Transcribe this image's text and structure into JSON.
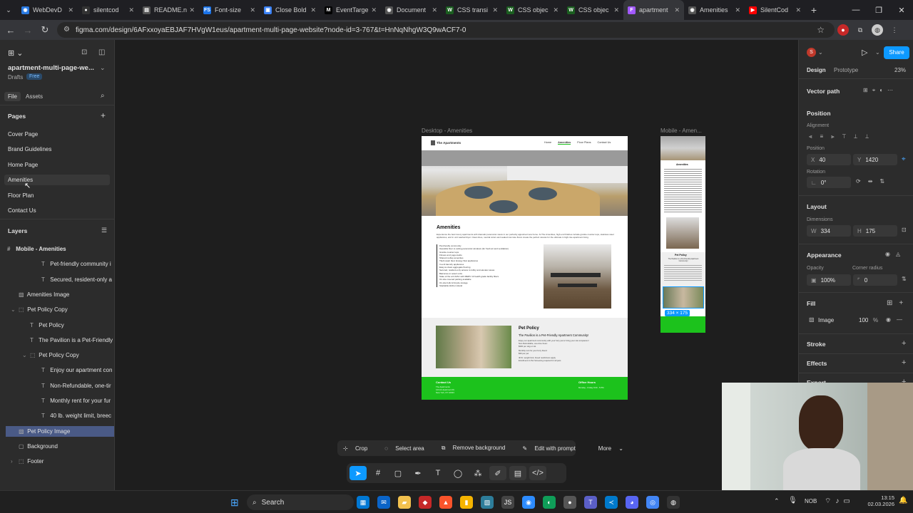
{
  "browser": {
    "tabs": [
      {
        "label": "WebDevD",
        "fav_color": "#2a7ae2",
        "fav_glyph": "◉"
      },
      {
        "label": "silentcod",
        "fav_color": "#333333",
        "fav_glyph": "●"
      },
      {
        "label": "README.n",
        "fav_color": "#555555",
        "fav_glyph": "▤"
      },
      {
        "label": "Font-size",
        "fav_color": "#1a73e8",
        "fav_glyph": "FS"
      },
      {
        "label": "Close Bold",
        "fav_color": "#3b82f6",
        "fav_glyph": "▣"
      },
      {
        "label": "EventTarge",
        "fav_color": "#000000",
        "fav_glyph": "M"
      },
      {
        "label": "Document",
        "fav_color": "#555555",
        "fav_glyph": "◉"
      },
      {
        "label": "CSS transi",
        "fav_color": "#1b5e20",
        "fav_glyph": "W"
      },
      {
        "label": "CSS objec",
        "fav_color": "#1b5e20",
        "fav_glyph": "W"
      },
      {
        "label": "CSS objec",
        "fav_color": "#1b5e20",
        "fav_glyph": "W"
      },
      {
        "label": "apartment",
        "fav_color": "#a259ff",
        "fav_glyph": "F",
        "active": true
      },
      {
        "label": "Amenities",
        "fav_color": "#555555",
        "fav_glyph": "◉"
      },
      {
        "label": "SilentCod",
        "fav_color": "#ff0000",
        "fav_glyph": "▶"
      }
    ],
    "url": "figma.com/design/6AFxxoyaEBJAF7HVgW1eus/apartment-multi-page-website?node-id=3-767&t=HnNqNhgW3Q9wACF7-0"
  },
  "left_panel": {
    "file_name": "apartment-multi-page-we...",
    "drafts": "Drafts",
    "plan_badge": "Free",
    "tab_file": "File",
    "tab_assets": "Assets",
    "pages_header": "Pages",
    "pages": [
      "Cover Page",
      "Brand Guidelines",
      "Home Page",
      "Amenities",
      "Floor Plan",
      "Contact Us"
    ],
    "layers_header": "Layers",
    "layers": [
      {
        "label": "Mobile - Amenities",
        "icon": "#",
        "indent": 0,
        "bold": true
      },
      {
        "label": "Pet-friendly community i",
        "icon": "T",
        "indent": 3
      },
      {
        "label": "Secured, resident-only a",
        "icon": "T",
        "indent": 3
      },
      {
        "label": "Amenities Image",
        "icon": "▧",
        "indent": 1
      },
      {
        "label": "Pet Policy Copy",
        "icon": "⬚",
        "indent": 1,
        "caret": "⌄"
      },
      {
        "label": "Pet Policy",
        "icon": "T",
        "indent": 2
      },
      {
        "label": "The Pavilion is a Pet-Friendly",
        "icon": "T",
        "indent": 2
      },
      {
        "label": "Pet Policy Copy",
        "icon": "⬚",
        "indent": 2,
        "caret": "⌄"
      },
      {
        "label": "Enjoy our apartment con",
        "icon": "T",
        "indent": 3
      },
      {
        "label": "Non-Refundable, one-tir",
        "icon": "T",
        "indent": 3
      },
      {
        "label": "Monthly rent for your fur",
        "icon": "T",
        "indent": 3
      },
      {
        "label": "40 lb. weight limit, breec",
        "icon": "T",
        "indent": 3
      },
      {
        "label": "Pet Policy Image",
        "icon": "▧",
        "indent": 1,
        "selected": true
      },
      {
        "label": "Background",
        "icon": "▢",
        "indent": 1
      },
      {
        "label": "Footer",
        "icon": "⬚",
        "indent": 1,
        "caret": "›"
      }
    ]
  },
  "canvas": {
    "desktop_frame_label": "Desktop - Amenities",
    "mobile_frame_label": "Mobile - Amen...",
    "selection_size": "334 × 175",
    "site": {
      "brand": "The Apartments",
      "nav": [
        "Home",
        "Amenities",
        "Floor Plans",
        "Contact Us"
      ],
      "amenities_title": "Amenities",
      "amenities_intro": "Experience the best luxury apartments with dramatic panoramic views in our perfectly appointed new home. At The Amenities, high end finishes include granite counter tops, stainless steel appliances, and in unit washer/dryer. Clean lines, neutral colors and sealed concrete floors create the perfect canvas for the ultimate in high-rise apartment living.",
      "amenities_list": [
        "Pet-friendly community",
        "Operable floor to ceiling panoramic windows (for fresh air and ventilation)",
        "Granite counter tops",
        "Fitness and yoga studio",
        "Shared rooftop amenities",
        "Tile/mosaic tiled, Energy Star appliances",
        "In-unit laundry appliances",
        "Easy-to-clean aggregate flooring",
        "Secured, resident-only access to lobby and elevator areas",
        "Balconies in select units",
        "State of the art HVAC with MERV 13 health grade facility filters",
        "On-site covered parking available",
        "On-site bulk & bicycle storage",
        "Stackable kitchen island"
      ],
      "pet_title": "Pet Policy",
      "pet_subtitle": "The Pavilion is a Pet-Friendly Apartment Community!",
      "pet_lines": [
        "Enjoy our apartment community with your furry pal or bring your cat companion!",
        "Non-Refundable, one-time Fees:",
        "$300 per dog or cat",
        "Monthly rent for your furry friend",
        "$30 per pet",
        "40 lb. weight limit, breed restrictions apply",
        "Enrollment in Pet Screening required for all pets"
      ],
      "footer_contact_title": "Contact Us",
      "footer_contact_lines": [
        "The Apartments",
        "123 Art Apartment Dr.",
        "New York, NY 10023"
      ],
      "footer_hours_title": "Office Hours",
      "footer_hours": "Monday - Friday 9:00 - 5 PM",
      "mobile_pet_title": "Pet Policy",
      "mobile_pet_sub": "The Pavilion is a Pet-Friendly Apartment Community!"
    },
    "context_toolbar": [
      "Crop",
      "Select area",
      "Remove background",
      "Edit with prompt",
      "More"
    ],
    "accent_green": "#1cc21c"
  },
  "right_panel": {
    "avatar": "S",
    "share": "Share",
    "tab_design": "Design",
    "tab_prototype": "Prototype",
    "zoom": "23%",
    "selection_type": "Vector path",
    "position_header": "Position",
    "alignment_label": "Alignment",
    "position_label": "Position",
    "x_key": "X",
    "x": "40",
    "y_key": "Y",
    "y": "1420",
    "rotation_label": "Rotation",
    "rotation": "0°",
    "layout_header": "Layout",
    "dimensions_label": "Dimensions",
    "w_key": "W",
    "w": "334",
    "h_key": "H",
    "h": "175",
    "appearance_header": "Appearance",
    "opacity_label": "Opacity",
    "opacity": "100%",
    "radius_label": "Corner radius",
    "radius": "0",
    "fill_header": "Fill",
    "fill_type": "Image",
    "fill_opacity": "100",
    "fill_pct": "%",
    "stroke_header": "Stroke",
    "effects_header": "Effects",
    "export_header": "Export"
  },
  "taskbar": {
    "search": "Search",
    "lang": "NOB",
    "time": "13:15",
    "date": "02.03.2026"
  }
}
